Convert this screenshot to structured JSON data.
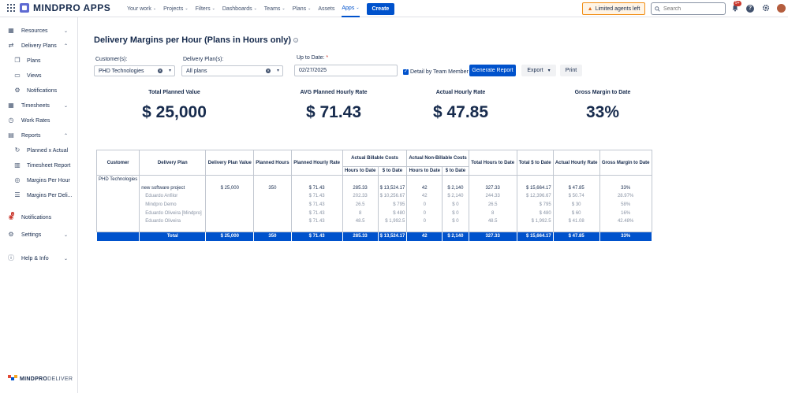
{
  "topbar": {
    "brand": "MINDPRO APPS",
    "nav": [
      {
        "label": "Your work",
        "chevron": true
      },
      {
        "label": "Projects",
        "chevron": true
      },
      {
        "label": "Filters",
        "chevron": true
      },
      {
        "label": "Dashboards",
        "chevron": true
      },
      {
        "label": "Teams",
        "chevron": true
      },
      {
        "label": "Plans",
        "chevron": true
      },
      {
        "label": "Assets",
        "chevron": false
      },
      {
        "label": "Apps",
        "chevron": true,
        "active": true
      }
    ],
    "create_label": "Create",
    "limited_label": "Limited agents left",
    "search_placeholder": "Search",
    "notifications_badge": "9+"
  },
  "sidebar": {
    "items": [
      {
        "label": "Resources",
        "icon": "grid-icon",
        "chevron": "down"
      },
      {
        "label": "Delivery Plans",
        "icon": "route-icon",
        "chevron": "up"
      },
      {
        "label": "Plans",
        "icon": "copy-icon",
        "sub": true
      },
      {
        "label": "Views",
        "icon": "monitor-icon",
        "sub": true
      },
      {
        "label": "Notifications",
        "icon": "gear-icon",
        "sub": true
      },
      {
        "label": "Timesheets",
        "icon": "calendar-icon",
        "chevron": "down"
      },
      {
        "label": "Work Rates",
        "icon": "clock-icon"
      },
      {
        "label": "Reports",
        "icon": "chart-icon",
        "chevron": "up"
      },
      {
        "label": "Planned x Actual",
        "icon": "refresh-icon",
        "sub": true
      },
      {
        "label": "Timesheet Report",
        "icon": "doc-icon",
        "sub": true
      },
      {
        "label": "Margins Per Hour",
        "icon": "target-icon",
        "sub": true
      },
      {
        "label": "Margins Per Deli...",
        "icon": "list-icon",
        "sub": true
      },
      {
        "label": "Notifications",
        "icon": "bell-icon",
        "badge": "1"
      },
      {
        "label": "Settings",
        "icon": "settings-icon",
        "chevron": "down"
      },
      {
        "label": "Help & Info",
        "icon": "info-icon",
        "chevron": "down"
      }
    ],
    "footer_brand_bold": "MINDPRO",
    "footer_brand_light": "DELIVER"
  },
  "page": {
    "title": "Delivery Margins per Hour (Plans in Hours only)",
    "filters": {
      "customer_label": "Customer(s):",
      "customer_value": "PHD Technologies",
      "plan_label": "Delivery Plan(s):",
      "plan_value": "All plans",
      "date_label": "Up to Date:",
      "date_required": "*",
      "date_value": "02/27/2025",
      "detail_label": "Detail by Team Member",
      "detail_checked": true,
      "generate_label": "Generate Report",
      "export_label": "Export",
      "print_label": "Print"
    },
    "kpis": [
      {
        "label": "Total Planned Value",
        "value": "$ 25,000"
      },
      {
        "label": "AVG Planned Hourly Rate",
        "value": "$ 71.43"
      },
      {
        "label": "Actual Hourly Rate",
        "value": "$ 47.85"
      },
      {
        "label": "Gross Margin to Date",
        "value": "33%"
      }
    ]
  },
  "report": {
    "headers": {
      "customer": "Customer",
      "plan": "Delivery Plan",
      "plan_value": "Delivery Plan Value",
      "planned_hours": "Planned Hours",
      "planned_rate": "Planned Hourly Rate",
      "billable": "Actual Billable Costs",
      "non_billable": "Actual Non-Billable Costs",
      "hours_to_date": "Hours to Date",
      "dollar_to_date": "$ to Date",
      "total_hours": "Total Hours to Date",
      "total_dollar": "Total $ to Date",
      "actual_rate": "Actual Hourly Rate",
      "gross_margin": "Gross Margin to Date"
    },
    "rows": [
      {
        "customer": "PHD Technologies",
        "plan": "",
        "plan_value": "",
        "planned_hours": "",
        "planned_rate": "",
        "b_hours": "",
        "b_dollar": "",
        "nb_hours": "",
        "nb_dollar": "",
        "total_hours": "",
        "total_dollar": "",
        "actual_rate": "",
        "margin": "",
        "sub": false
      },
      {
        "customer": "",
        "plan": "new software project",
        "plan_value": "$ 25,000",
        "planned_hours": "350",
        "planned_rate": "$ 71.43",
        "b_hours": "285.33",
        "b_dollar": "$ 13,524.17",
        "nb_hours": "42",
        "nb_dollar": "$ 2,140",
        "total_hours": "327.33",
        "total_dollar": "$ 15,664.17",
        "actual_rate": "$ 47.85",
        "margin": "33%",
        "sub": false
      },
      {
        "customer": "",
        "plan": "Eduardo Anfilor",
        "plan_value": "",
        "planned_hours": "",
        "planned_rate": "$ 71.43",
        "b_hours": "202.33",
        "b_dollar": "$ 10,256.67",
        "nb_hours": "42",
        "nb_dollar": "$ 2,140",
        "total_hours": "244.33",
        "total_dollar": "$ 12,396.67",
        "actual_rate": "$ 50.74",
        "margin": "28.97%",
        "sub": true
      },
      {
        "customer": "",
        "plan": "Mindpro Demo",
        "plan_value": "",
        "planned_hours": "",
        "planned_rate": "$ 71.43",
        "b_hours": "26.5",
        "b_dollar": "$ 795",
        "nb_hours": "0",
        "nb_dollar": "$ 0",
        "total_hours": "26.5",
        "total_dollar": "$ 795",
        "actual_rate": "$ 30",
        "margin": "58%",
        "sub": true
      },
      {
        "customer": "",
        "plan": "Eduardo Oliveira [Mindpro]",
        "plan_value": "",
        "planned_hours": "",
        "planned_rate": "$ 71.43",
        "b_hours": "8",
        "b_dollar": "$ 480",
        "nb_hours": "0",
        "nb_dollar": "$ 0",
        "total_hours": "8",
        "total_dollar": "$ 480",
        "actual_rate": "$ 60",
        "margin": "16%",
        "sub": true
      },
      {
        "customer": "",
        "plan": "Eduardo Oliveira",
        "plan_value": "",
        "planned_hours": "",
        "planned_rate": "$ 71.43",
        "b_hours": "48.5",
        "b_dollar": "$ 1,992.5",
        "nb_hours": "0",
        "nb_dollar": "$ 0",
        "total_hours": "48.5",
        "total_dollar": "$ 1,992.5",
        "actual_rate": "$ 41.08",
        "margin": "42.48%",
        "sub": true
      }
    ],
    "total": {
      "label": "Total",
      "plan_value": "$ 25,000",
      "planned_hours": "350",
      "planned_rate": "$ 71.43",
      "b_hours": "285.33",
      "b_dollar": "$ 13,524.17",
      "nb_hours": "42",
      "nb_dollar": "$ 2,140",
      "total_hours": "327.33",
      "total_dollar": "$ 15,664.17",
      "actual_rate": "$ 47.85",
      "margin": "33%"
    }
  },
  "colors": {
    "accent": "#0052cc",
    "warning_border": "#f18d13",
    "badge": "#c9372c"
  }
}
